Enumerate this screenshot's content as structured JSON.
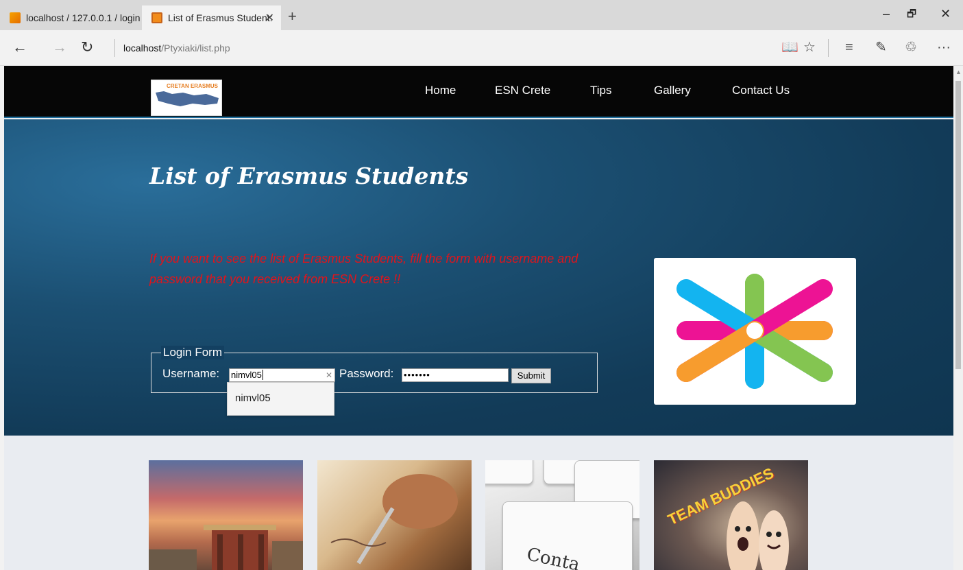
{
  "browser": {
    "tabs": [
      {
        "label": "localhost / 127.0.0.1 / login",
        "active": false
      },
      {
        "label": "List of Erasmus Student:",
        "active": true
      }
    ],
    "new_tab_icon": "plus-icon",
    "window_controls": {
      "minimize": "–",
      "restore": "🗗",
      "close": "✕"
    },
    "nav": {
      "back": "←",
      "forward": "→",
      "refresh": "↻"
    },
    "url_host": "localhost",
    "url_path": "/Ptyxiaki/list.php",
    "toolbar_icons": {
      "reading_view": "📖",
      "favorite": "☆",
      "hub": "≡",
      "notes": "✎",
      "share": "♲",
      "more": "···"
    }
  },
  "site": {
    "logo_text": "CRETAN ERASMUS",
    "nav": [
      "Home",
      "ESN Crete",
      "Tips",
      "Gallery",
      "Contact Us"
    ]
  },
  "hero": {
    "title": "List of Erasmus Students",
    "message": "If you want to see the list of Erasmus Students, fill the form with username and password that you received from ESN Crete !!"
  },
  "login_form": {
    "legend": "Login Form",
    "username_label": "Username:",
    "username_value": "nimvl05",
    "password_label": "Password:",
    "password_value": "•••••••",
    "submit_label": "Submit",
    "autocomplete_suggestion": "nimvl05"
  },
  "thumbnails": {
    "contact_key_text": "Conta",
    "buddies_text": "TEAM BUDDIES"
  },
  "colors": {
    "header_bg": "#060606",
    "hero_bg": "#164766",
    "message_red": "#e0141b"
  }
}
